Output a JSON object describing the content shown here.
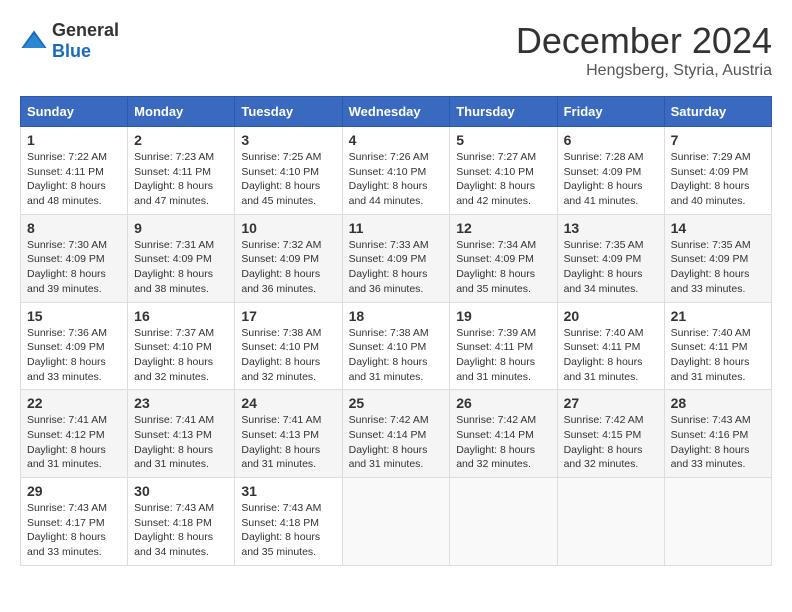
{
  "logo": {
    "general": "General",
    "blue": "Blue"
  },
  "header": {
    "month": "December 2024",
    "location": "Hengsberg, Styria, Austria"
  },
  "weekdays": [
    "Sunday",
    "Monday",
    "Tuesday",
    "Wednesday",
    "Thursday",
    "Friday",
    "Saturday"
  ],
  "weeks": [
    [
      {
        "day": "1",
        "sunrise": "7:22 AM",
        "sunset": "4:11 PM",
        "daylight": "8 hours and 48 minutes."
      },
      {
        "day": "2",
        "sunrise": "7:23 AM",
        "sunset": "4:11 PM",
        "daylight": "8 hours and 47 minutes."
      },
      {
        "day": "3",
        "sunrise": "7:25 AM",
        "sunset": "4:10 PM",
        "daylight": "8 hours and 45 minutes."
      },
      {
        "day": "4",
        "sunrise": "7:26 AM",
        "sunset": "4:10 PM",
        "daylight": "8 hours and 44 minutes."
      },
      {
        "day": "5",
        "sunrise": "7:27 AM",
        "sunset": "4:10 PM",
        "daylight": "8 hours and 42 minutes."
      },
      {
        "day": "6",
        "sunrise": "7:28 AM",
        "sunset": "4:09 PM",
        "daylight": "8 hours and 41 minutes."
      },
      {
        "day": "7",
        "sunrise": "7:29 AM",
        "sunset": "4:09 PM",
        "daylight": "8 hours and 40 minutes."
      }
    ],
    [
      {
        "day": "8",
        "sunrise": "7:30 AM",
        "sunset": "4:09 PM",
        "daylight": "8 hours and 39 minutes."
      },
      {
        "day": "9",
        "sunrise": "7:31 AM",
        "sunset": "4:09 PM",
        "daylight": "8 hours and 38 minutes."
      },
      {
        "day": "10",
        "sunrise": "7:32 AM",
        "sunset": "4:09 PM",
        "daylight": "8 hours and 36 minutes."
      },
      {
        "day": "11",
        "sunrise": "7:33 AM",
        "sunset": "4:09 PM",
        "daylight": "8 hours and 36 minutes."
      },
      {
        "day": "12",
        "sunrise": "7:34 AM",
        "sunset": "4:09 PM",
        "daylight": "8 hours and 35 minutes."
      },
      {
        "day": "13",
        "sunrise": "7:35 AM",
        "sunset": "4:09 PM",
        "daylight": "8 hours and 34 minutes."
      },
      {
        "day": "14",
        "sunrise": "7:35 AM",
        "sunset": "4:09 PM",
        "daylight": "8 hours and 33 minutes."
      }
    ],
    [
      {
        "day": "15",
        "sunrise": "7:36 AM",
        "sunset": "4:09 PM",
        "daylight": "8 hours and 33 minutes."
      },
      {
        "day": "16",
        "sunrise": "7:37 AM",
        "sunset": "4:10 PM",
        "daylight": "8 hours and 32 minutes."
      },
      {
        "day": "17",
        "sunrise": "7:38 AM",
        "sunset": "4:10 PM",
        "daylight": "8 hours and 32 minutes."
      },
      {
        "day": "18",
        "sunrise": "7:38 AM",
        "sunset": "4:10 PM",
        "daylight": "8 hours and 31 minutes."
      },
      {
        "day": "19",
        "sunrise": "7:39 AM",
        "sunset": "4:11 PM",
        "daylight": "8 hours and 31 minutes."
      },
      {
        "day": "20",
        "sunrise": "7:40 AM",
        "sunset": "4:11 PM",
        "daylight": "8 hours and 31 minutes."
      },
      {
        "day": "21",
        "sunrise": "7:40 AM",
        "sunset": "4:11 PM",
        "daylight": "8 hours and 31 minutes."
      }
    ],
    [
      {
        "day": "22",
        "sunrise": "7:41 AM",
        "sunset": "4:12 PM",
        "daylight": "8 hours and 31 minutes."
      },
      {
        "day": "23",
        "sunrise": "7:41 AM",
        "sunset": "4:13 PM",
        "daylight": "8 hours and 31 minutes."
      },
      {
        "day": "24",
        "sunrise": "7:41 AM",
        "sunset": "4:13 PM",
        "daylight": "8 hours and 31 minutes."
      },
      {
        "day": "25",
        "sunrise": "7:42 AM",
        "sunset": "4:14 PM",
        "daylight": "8 hours and 31 minutes."
      },
      {
        "day": "26",
        "sunrise": "7:42 AM",
        "sunset": "4:14 PM",
        "daylight": "8 hours and 32 minutes."
      },
      {
        "day": "27",
        "sunrise": "7:42 AM",
        "sunset": "4:15 PM",
        "daylight": "8 hours and 32 minutes."
      },
      {
        "day": "28",
        "sunrise": "7:43 AM",
        "sunset": "4:16 PM",
        "daylight": "8 hours and 33 minutes."
      }
    ],
    [
      {
        "day": "29",
        "sunrise": "7:43 AM",
        "sunset": "4:17 PM",
        "daylight": "8 hours and 33 minutes."
      },
      {
        "day": "30",
        "sunrise": "7:43 AM",
        "sunset": "4:18 PM",
        "daylight": "8 hours and 34 minutes."
      },
      {
        "day": "31",
        "sunrise": "7:43 AM",
        "sunset": "4:18 PM",
        "daylight": "8 hours and 35 minutes."
      },
      null,
      null,
      null,
      null
    ]
  ]
}
